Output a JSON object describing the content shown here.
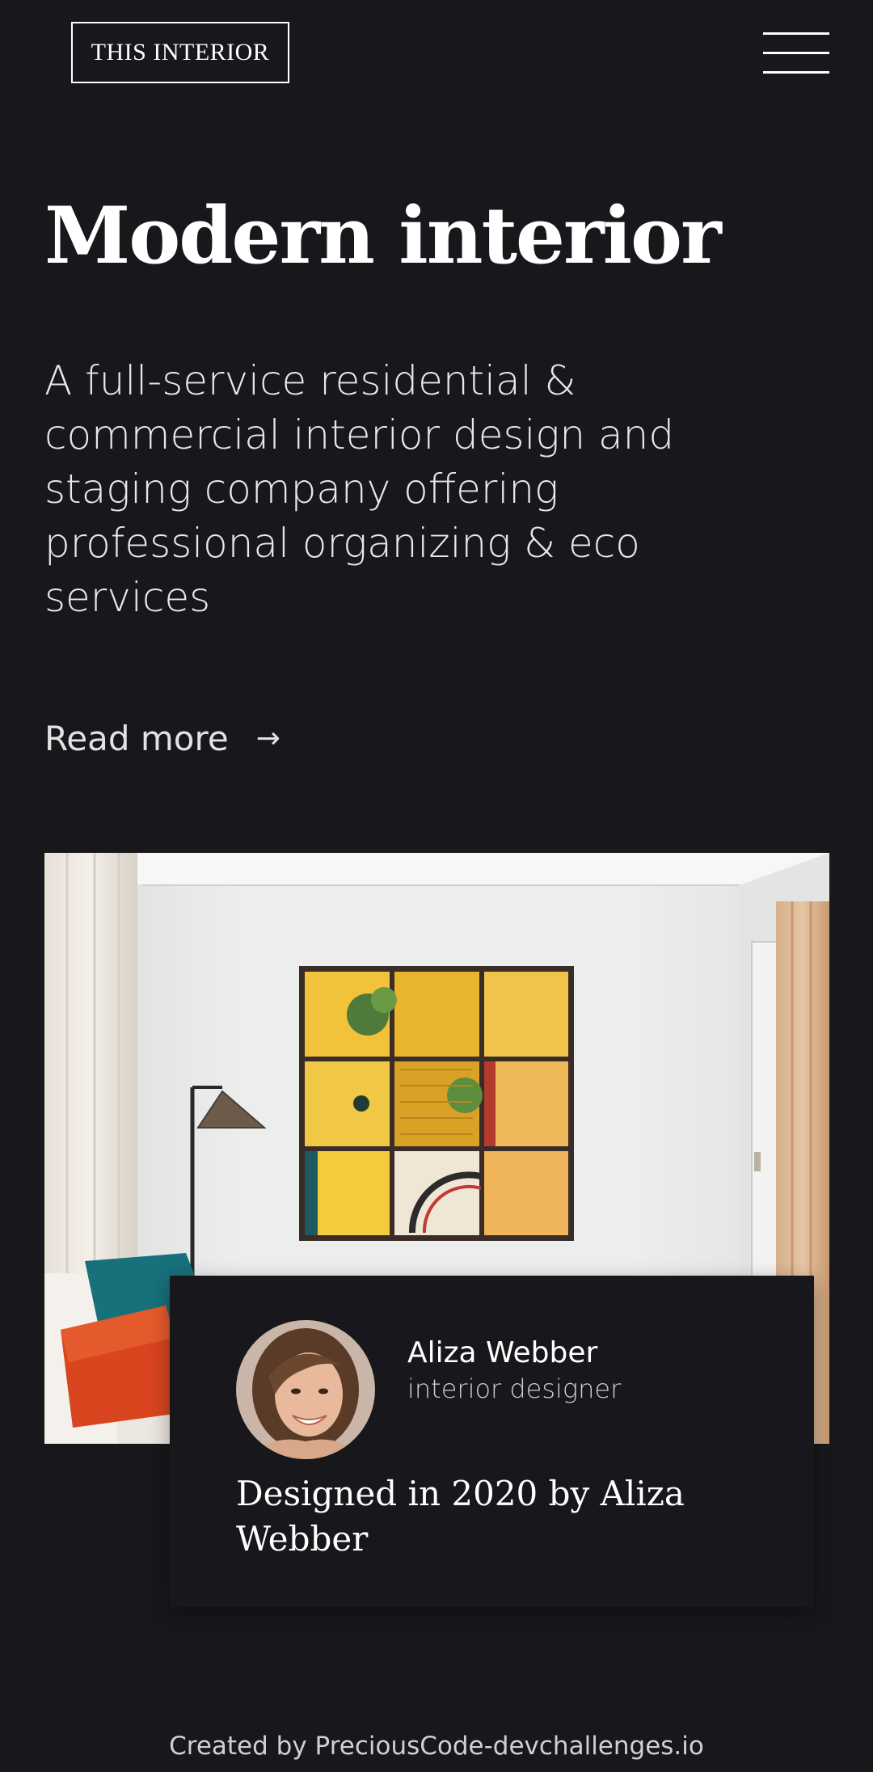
{
  "header": {
    "logo_text": "THIS INTERIOR",
    "menu_icon": "hamburger-menu-icon"
  },
  "hero": {
    "title": "Modern interior",
    "description": "A full-service residential & commercial interior design and staging company offering professional organizing & eco services",
    "read_more_label": "Read more",
    "read_more_arrow": "→"
  },
  "feature": {
    "image_subject": "living room with yellow wooden wall art, floor lamp, sofa with teal and orange cushions"
  },
  "card": {
    "author_name": "Aliza Webber",
    "author_role": "interior designer",
    "caption": "Designed in 2020 by Aliza Webber"
  },
  "footer": {
    "text": "Created by PreciousCode-devchallenges.io"
  },
  "colors": {
    "background": "#18171b",
    "text": "#ffffff",
    "muted_text": "#cfcfcf",
    "art_yellow": "#f2c23a"
  }
}
